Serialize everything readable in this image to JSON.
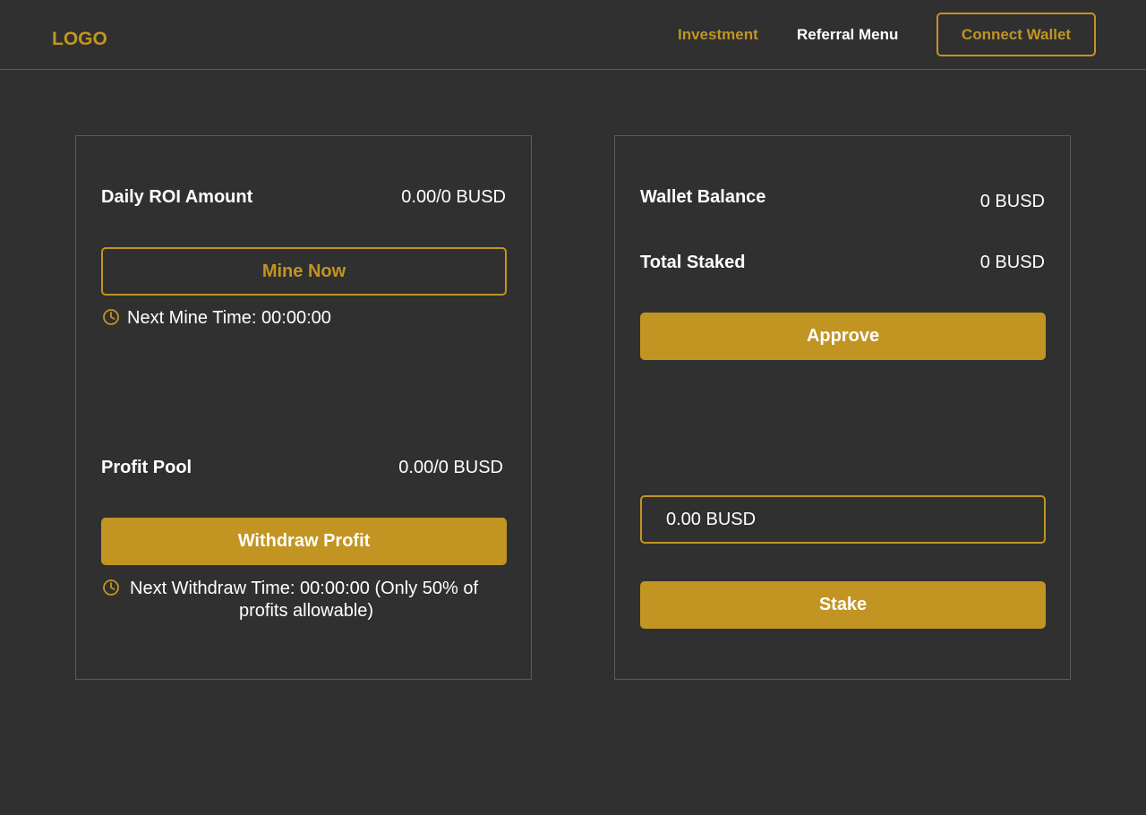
{
  "header": {
    "logo": "LOGO",
    "nav": {
      "investment": "Investment",
      "referral": "Referral Menu"
    },
    "connect_wallet": "Connect Wallet"
  },
  "left_card": {
    "daily_roi": {
      "label": "Daily ROI Amount",
      "value": "0.00/0 BUSD"
    },
    "mine_button": "Mine Now",
    "next_mine": "Next Mine Time: 00:00:00",
    "profit_pool": {
      "label": "Profit Pool",
      "value": "0.00/0 BUSD"
    },
    "withdraw_button": "Withdraw Profit",
    "next_withdraw_line1": "Next Withdraw Time: 00:00:00 (Only 50% of",
    "next_withdraw_line2": "profits allowable)"
  },
  "right_card": {
    "wallet_balance": {
      "label": "Wallet Balance",
      "value": "0 BUSD"
    },
    "total_staked": {
      "label": "Total Staked",
      "value": "0 BUSD"
    },
    "approve_button": "Approve",
    "amount_input": {
      "value": "0.00 BUSD"
    },
    "stake_button": "Stake"
  },
  "colors": {
    "background": "#303030",
    "accent": "#c29422",
    "text": "#ffffff",
    "card_border": "#5b5b5b"
  },
  "icons": {
    "timer": "clock-icon"
  }
}
